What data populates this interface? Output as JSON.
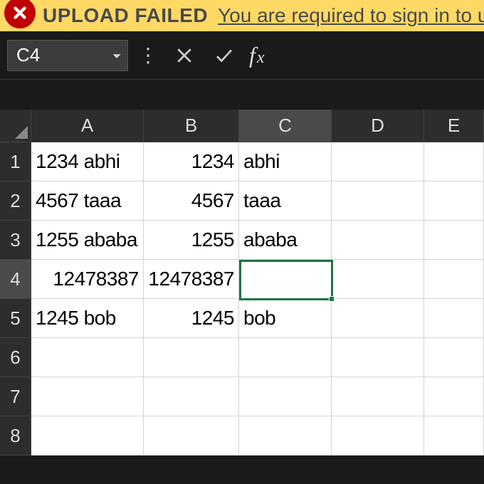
{
  "banner": {
    "title": "UPLOAD FAILED",
    "message": "You are required to sign in to upload you"
  },
  "formula_bar": {
    "active_cell": "C4",
    "fx_label": "fx"
  },
  "columns": [
    "A",
    "B",
    "C",
    "D",
    "E"
  ],
  "row_numbers": [
    "1",
    "2",
    "3",
    "4",
    "5",
    "6",
    "7",
    "8"
  ],
  "selection": {
    "col": "C",
    "row": 4
  },
  "cells": {
    "r1": {
      "A": "1234 abhi",
      "B": "1234",
      "C": "abhi"
    },
    "r2": {
      "A": "4567 taaa",
      "B": "4567",
      "C": "taaa"
    },
    "r3": {
      "A": "1255 ababa",
      "B": "1255",
      "C": "ababa"
    },
    "r4": {
      "A": "12478387",
      "B": "12478387",
      "C": ""
    },
    "r5": {
      "A": "1245 bob",
      "B": "1245",
      "C": "bob"
    }
  }
}
